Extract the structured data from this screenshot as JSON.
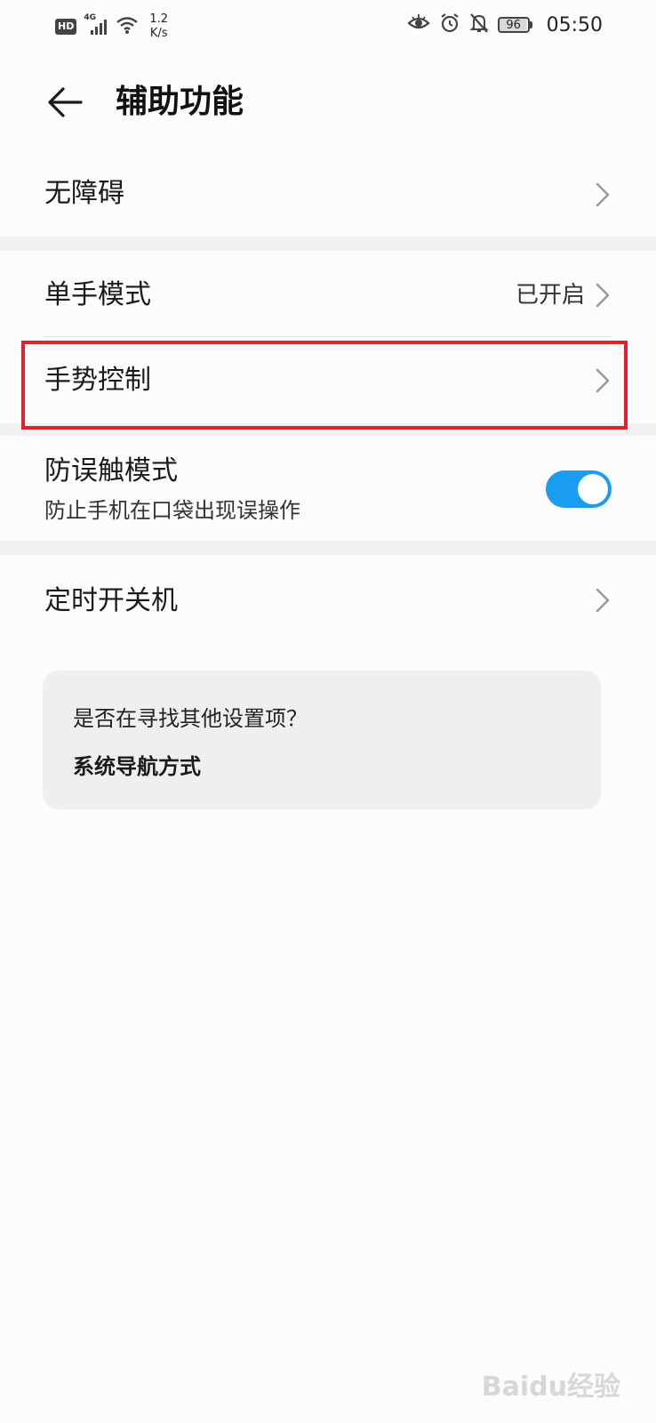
{
  "status_bar": {
    "hd_label": "HD",
    "network_type": "4G",
    "net_speed_value": "1.2",
    "net_speed_unit": "K/s",
    "battery_level": "96",
    "time": "05:50"
  },
  "header": {
    "title": "辅助功能"
  },
  "settings": {
    "accessibility": {
      "label": "无障碍"
    },
    "one_hand": {
      "label": "单手模式",
      "value": "已开启"
    },
    "gesture": {
      "label": "手势控制"
    },
    "anti_touch": {
      "label": "防误触模式",
      "description": "防止手机在口袋出现误操作",
      "enabled": true
    },
    "scheduled_power": {
      "label": "定时开关机"
    }
  },
  "suggestion": {
    "question": "是否在寻找其他设置项？",
    "link_label": "系统导航方式"
  },
  "watermark": "Baidu经验",
  "colors": {
    "accent": "#1a9cf0",
    "highlight": "#e0222c",
    "separator": "#f1f0f3"
  }
}
